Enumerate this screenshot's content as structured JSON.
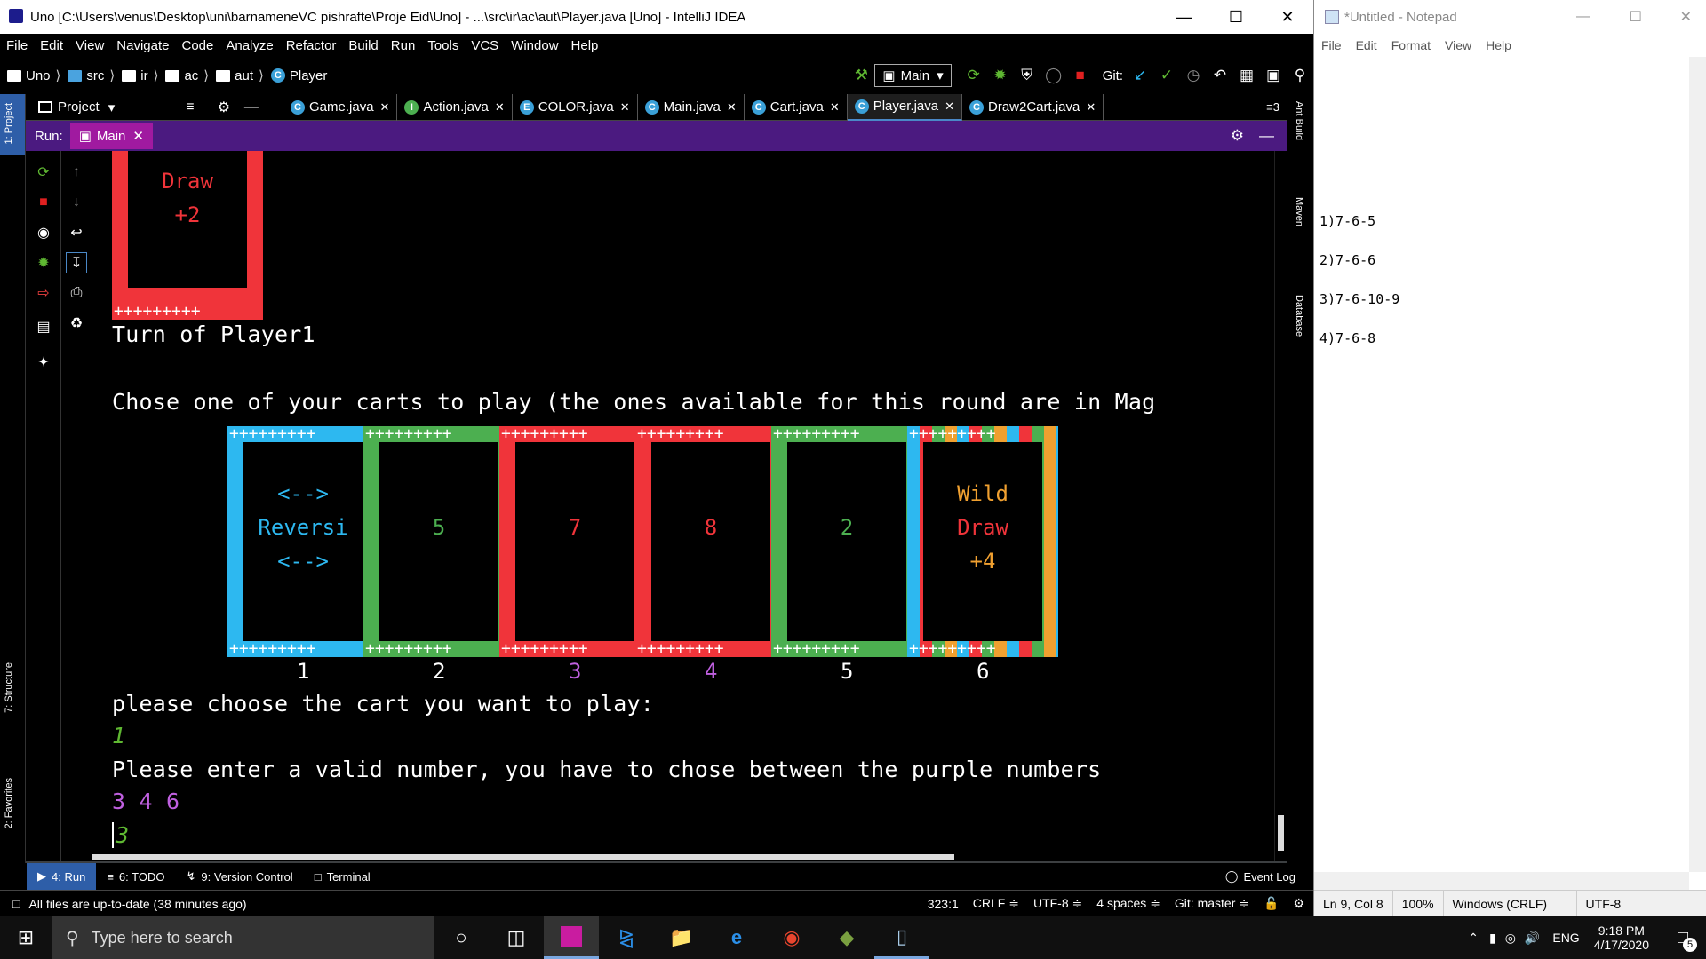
{
  "idea": {
    "title": "Uno [C:\\Users\\venus\\Desktop\\uni\\barnameneVC pishrafte\\Proje Eid\\Uno] - ...\\src\\ir\\ac\\aut\\Player.java [Uno] - IntelliJ IDEA",
    "menu": [
      "File",
      "Edit",
      "View",
      "Navigate",
      "Code",
      "Analyze",
      "Refactor",
      "Build",
      "Run",
      "Tools",
      "VCS",
      "Window",
      "Help"
    ],
    "breadcrumbs": [
      "Uno",
      "src",
      "ir",
      "ac",
      "aut",
      "Player"
    ],
    "run_config": "Main",
    "git_label": "Git:",
    "project_label": "Project",
    "tabs": [
      {
        "label": "Game.java",
        "icon": "C",
        "color": "#3aa0d8"
      },
      {
        "label": "Action.java",
        "icon": "I",
        "color": "#4caf50"
      },
      {
        "label": "COLOR.java",
        "icon": "E",
        "color": "#3aa0d8"
      },
      {
        "label": "Main.java",
        "icon": "C",
        "color": "#3aa0d8"
      },
      {
        "label": "Cart.java",
        "icon": "C",
        "color": "#3aa0d8"
      },
      {
        "label": "Player.java",
        "icon": "C",
        "color": "#3aa0d8",
        "active": true
      },
      {
        "label": "Draw2Cart.java",
        "icon": "C",
        "color": "#3aa0d8"
      }
    ],
    "tabs_more": "≡3",
    "run_label": "Run:",
    "run_tab": "Main",
    "left_tabs": [
      "1: Project",
      "7: Structure",
      "2: Favorites"
    ],
    "right_tabs": [
      "Ant Build",
      "Maven",
      "Database"
    ],
    "console": {
      "top_card": {
        "line1": "Draw",
        "line2": "+2",
        "color": "#f0343a",
        "border_color": "#f0343a"
      },
      "turn": "Turn of Player1",
      "choose": "Chose one of your carts to play (the ones available for this round are in Mag",
      "cards": [
        {
          "lines": [
            "<-->",
            "Reversi",
            "<-->"
          ],
          "color": "#2db8f0",
          "text_color": "#2db8f0",
          "num": "1",
          "num_color": "#ffffff"
        },
        {
          "lines": [
            "",
            "5",
            ""
          ],
          "color": "#4caf50",
          "text_color": "#4caf50",
          "num": "2",
          "num_color": "#ffffff"
        },
        {
          "lines": [
            "",
            "7",
            ""
          ],
          "color": "#f0343a",
          "text_color": "#f0343a",
          "num": "3",
          "num_color": "#c060e0"
        },
        {
          "lines": [
            "",
            "8",
            ""
          ],
          "color": "#f0343a",
          "text_color": "#f0343a",
          "num": "4",
          "num_color": "#c060e0"
        },
        {
          "lines": [
            "",
            "2",
            ""
          ],
          "color": "#4caf50",
          "text_color": "#4caf50",
          "num": "5",
          "num_color": "#ffffff"
        },
        {
          "lines": [
            "Wild",
            "Draw",
            "+4"
          ],
          "color": "wild",
          "text_color": "#f0a030",
          "num": "6",
          "num_color": "#ffffff"
        }
      ],
      "prompt": "please choose the cart you want to play:",
      "input1": "1",
      "invalid": "Please enter a valid number, you have to chose between the purple numbers",
      "valid_nums": "3 4 6",
      "input2": "3"
    },
    "bottom_tabs": [
      "4: Run",
      "6: TODO",
      "9: Version Control",
      "Terminal"
    ],
    "event_log": "Event Log",
    "status": {
      "message": "All files are up-to-date (38 minutes ago)",
      "position": "323:1",
      "line_sep": "CRLF ≑",
      "encoding": "UTF-8 ≑",
      "indent": "4 spaces ≑",
      "git": "Git: master ≑"
    }
  },
  "notepad": {
    "title": "*Untitled - Notepad",
    "menu": [
      "File",
      "Edit",
      "Format",
      "View",
      "Help"
    ],
    "lines": [
      "1)7-6-5",
      "2)7-6-6",
      "3)7-6-10-9",
      "4)7-6-8"
    ],
    "status": [
      "Ln 9, Col 8",
      "100%",
      "Windows (CRLF)",
      "UTF-8"
    ]
  },
  "taskbar": {
    "search_placeholder": "Type here to search",
    "lang": "ENG",
    "time": "9:18 PM",
    "date": "4/17/2020",
    "notif_count": "5"
  }
}
